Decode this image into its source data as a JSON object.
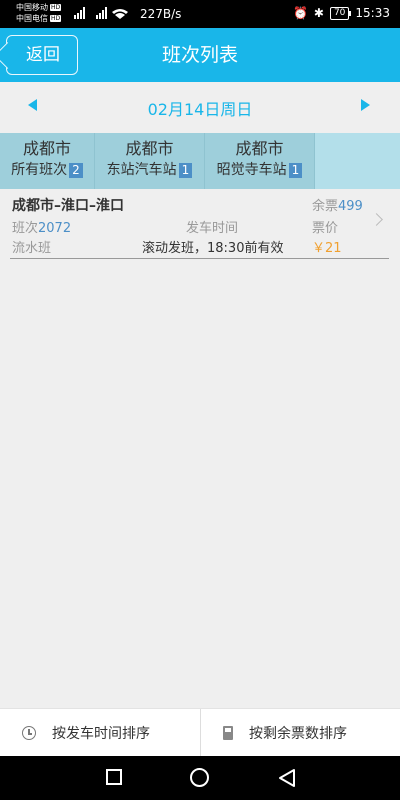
{
  "status_bar": {
    "carrier1": "中国移动",
    "carrier2": "中国电信",
    "hd_badge": "HD",
    "net_speed": "227B/s",
    "battery": "70",
    "time": "15:33"
  },
  "header": {
    "back_label": "返回",
    "title": "班次列表"
  },
  "date_bar": {
    "date_label": "02月14日周日"
  },
  "stations": [
    {
      "city": "成都市",
      "name": "所有班次",
      "count": "2"
    },
    {
      "city": "成都市",
      "name": "东站汽车站",
      "count": "1"
    },
    {
      "city": "成都市",
      "name": "昭觉寺车站",
      "count": "1"
    }
  ],
  "routes": [
    {
      "route": "成都市–淮口–淮口",
      "remain_label": "余票",
      "remain_count": "499",
      "no_label": "班次",
      "no_value": "2072",
      "depart_label": "发车时间",
      "price_label": "票价",
      "type": "流水班",
      "depart_value": "滚动发班，18:30前有效",
      "price": "￥21"
    }
  ],
  "sort_bar": {
    "sort_by_time": "按发车时间排序",
    "sort_by_remain": "按剩余票数排序"
  },
  "colors": {
    "accent": "#19b6e9",
    "station_bar": "#9ecfdb",
    "badge": "#4c8fc7",
    "price": "#f0a030"
  }
}
